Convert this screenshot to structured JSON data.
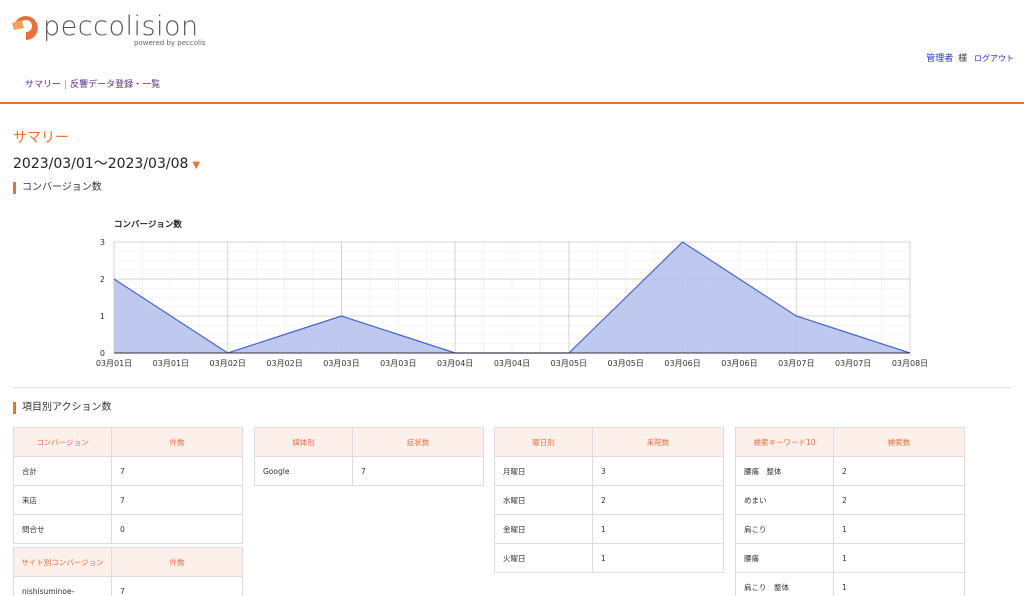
{
  "brand": {
    "name": "peccolision",
    "sub": "powered by peccolis",
    "color": "#e8703a"
  },
  "user": {
    "name": "管理者",
    "suffix": "様",
    "logout": "ログアウト"
  },
  "nav": {
    "summary": "サマリー",
    "separator": "|",
    "register": "反響データ登録・一覧"
  },
  "page": {
    "title": "サマリー",
    "date_range": "2023/03/01〜2023/03/08",
    "caret": "▼"
  },
  "sections": {
    "conversions": "コンバージョン数",
    "actions": "項目別アクション数"
  },
  "chart_data": {
    "type": "area",
    "title": "コンバージョン数",
    "x": [
      "03月01日",
      "03月01日",
      "03月02日",
      "03月02日",
      "03月03日",
      "03月03日",
      "03月04日",
      "03月04日",
      "03月05日",
      "03月05日",
      "03月06日",
      "03月06日",
      "03月07日",
      "03月07日",
      "03月08日"
    ],
    "values": [
      2,
      1,
      0,
      0.5,
      1,
      0.5,
      0,
      0,
      0,
      1.5,
      3,
      2,
      1,
      0.5,
      0
    ],
    "ylim": [
      0,
      3
    ],
    "yticks": [
      "0",
      "1",
      "2",
      "3"
    ],
    "grid": true,
    "line_color": "#4466cc",
    "fill_color": "#b4c0ec"
  },
  "tables": {
    "conversion": {
      "headers": [
        "コンバージョン",
        "件数"
      ],
      "rows": [
        [
          "合計",
          "7"
        ],
        [
          "来店",
          "7"
        ],
        [
          "問合せ",
          "0"
        ]
      ]
    },
    "site_conversion": {
      "headers": [
        "サイト別コンバージョン",
        "件数"
      ],
      "rows": [
        [
          "nishisuminoe-",
          "7"
        ]
      ]
    },
    "media": {
      "headers": [
        "媒体別",
        "症状数"
      ],
      "rows": [
        [
          "Google",
          "7"
        ]
      ]
    },
    "weekday": {
      "headers": [
        "曜日別",
        "来院数"
      ],
      "rows": [
        [
          "月曜日",
          "3"
        ],
        [
          "水曜日",
          "2"
        ],
        [
          "金曜日",
          "1"
        ],
        [
          "火曜日",
          "1"
        ]
      ]
    },
    "keywords": {
      "headers": [
        "検索キーワード10",
        "検索数"
      ],
      "rows": [
        [
          "腰痛　整体",
          "2"
        ],
        [
          "めまい",
          "2"
        ],
        [
          "肩こり",
          "1"
        ],
        [
          "腰痛",
          "1"
        ],
        [
          "肩こり　整体",
          "1"
        ]
      ]
    }
  }
}
